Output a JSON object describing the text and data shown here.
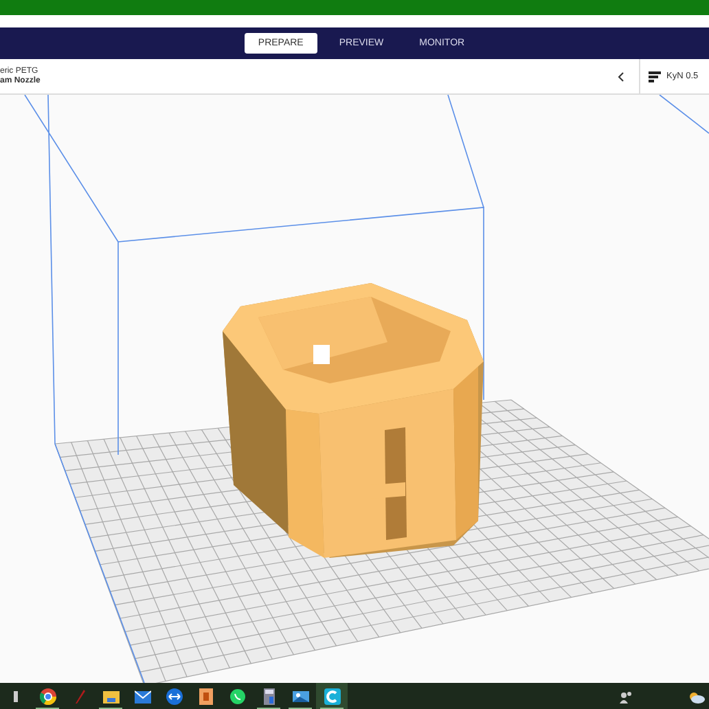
{
  "stages": [
    {
      "label": "PREPARE",
      "selected": true
    },
    {
      "label": "PREVIEW",
      "selected": false
    },
    {
      "label": "MONITOR",
      "selected": false
    }
  ],
  "printer": {
    "material": "eric PETG",
    "nozzle": "am Nozzle"
  },
  "profile": {
    "name": "KyN 0.5"
  },
  "taskbar": {
    "apps": [
      {
        "kind": "browser",
        "active": true
      },
      {
        "kind": "pen",
        "active": false
      },
      {
        "kind": "folder",
        "active": true
      },
      {
        "kind": "mail",
        "active": false
      },
      {
        "kind": "arrows",
        "active": false
      },
      {
        "kind": "document",
        "active": false
      },
      {
        "kind": "chat",
        "active": false
      },
      {
        "kind": "calculator",
        "active": true
      },
      {
        "kind": "photo",
        "active": true
      },
      {
        "kind": "slicer",
        "active": true
      }
    ]
  }
}
